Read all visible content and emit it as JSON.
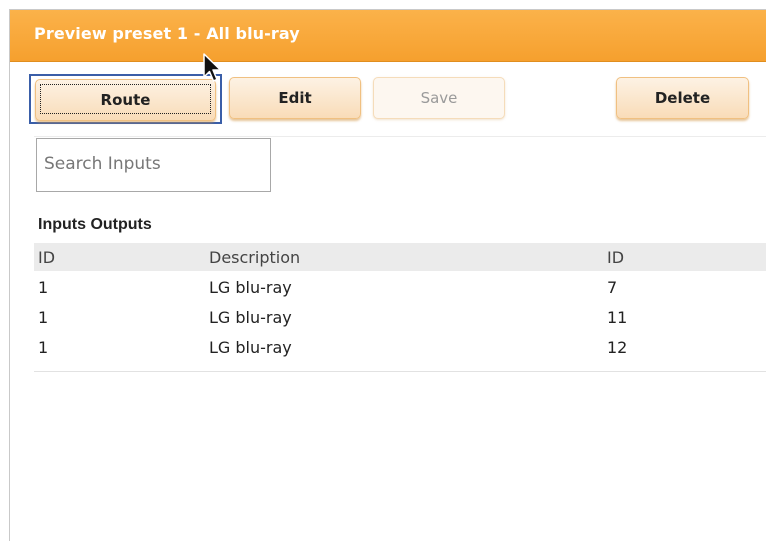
{
  "window": {
    "title": "Preview preset 1 - All blu-ray"
  },
  "toolbar": {
    "route_label": "Route",
    "edit_label": "Edit",
    "save_label": "Save",
    "delete_label": "Delete"
  },
  "search": {
    "placeholder": "Search Inputs"
  },
  "table": {
    "section_label": "Inputs Outputs",
    "columns": [
      "ID",
      "Description",
      "ID"
    ],
    "rows": [
      [
        "1",
        "LG blu-ray",
        "7"
      ],
      [
        "1",
        "LG blu-ray",
        "11"
      ],
      [
        "1",
        "LG blu-ray",
        "12"
      ]
    ]
  },
  "colors": {
    "titlebar": "#f7a535",
    "button_bg": "#fbe6cb",
    "focus_border": "#3a5ea8"
  },
  "icons": {
    "cursor": "arrow-pointer-icon"
  }
}
